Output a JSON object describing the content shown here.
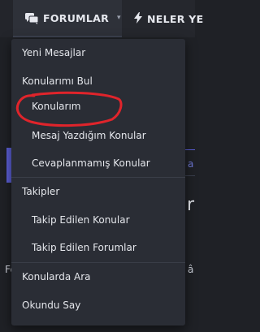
{
  "nav": {
    "forums_tab": {
      "label": "FORUMLAR",
      "icon": "chat-bubbles-icon",
      "caret": "▾"
    },
    "news_tab": {
      "label": "NELER YE",
      "icon": "lightning-icon"
    }
  },
  "background": {
    "fragment_a1": "a",
    "fragment_r": "r",
    "fragment_a2": "â",
    "fragment_f": "Fo"
  },
  "menu": {
    "items": [
      {
        "label": "Yeni Mesajlar"
      },
      {
        "label": "Konularımı Bul"
      },
      {
        "label": "Konularım"
      },
      {
        "label": "Mesaj Yazdığım Konular"
      },
      {
        "label": "Cevaplanmamış Konular"
      },
      {
        "label": "Takipler"
      },
      {
        "label": "Takip Edilen Konular"
      },
      {
        "label": "Takip Edilen Forumlar"
      },
      {
        "label": "Konularda Ara"
      },
      {
        "label": "Okundu Say"
      }
    ]
  },
  "colors": {
    "highlight": "#e0242b",
    "accent": "#5b5fd6"
  }
}
